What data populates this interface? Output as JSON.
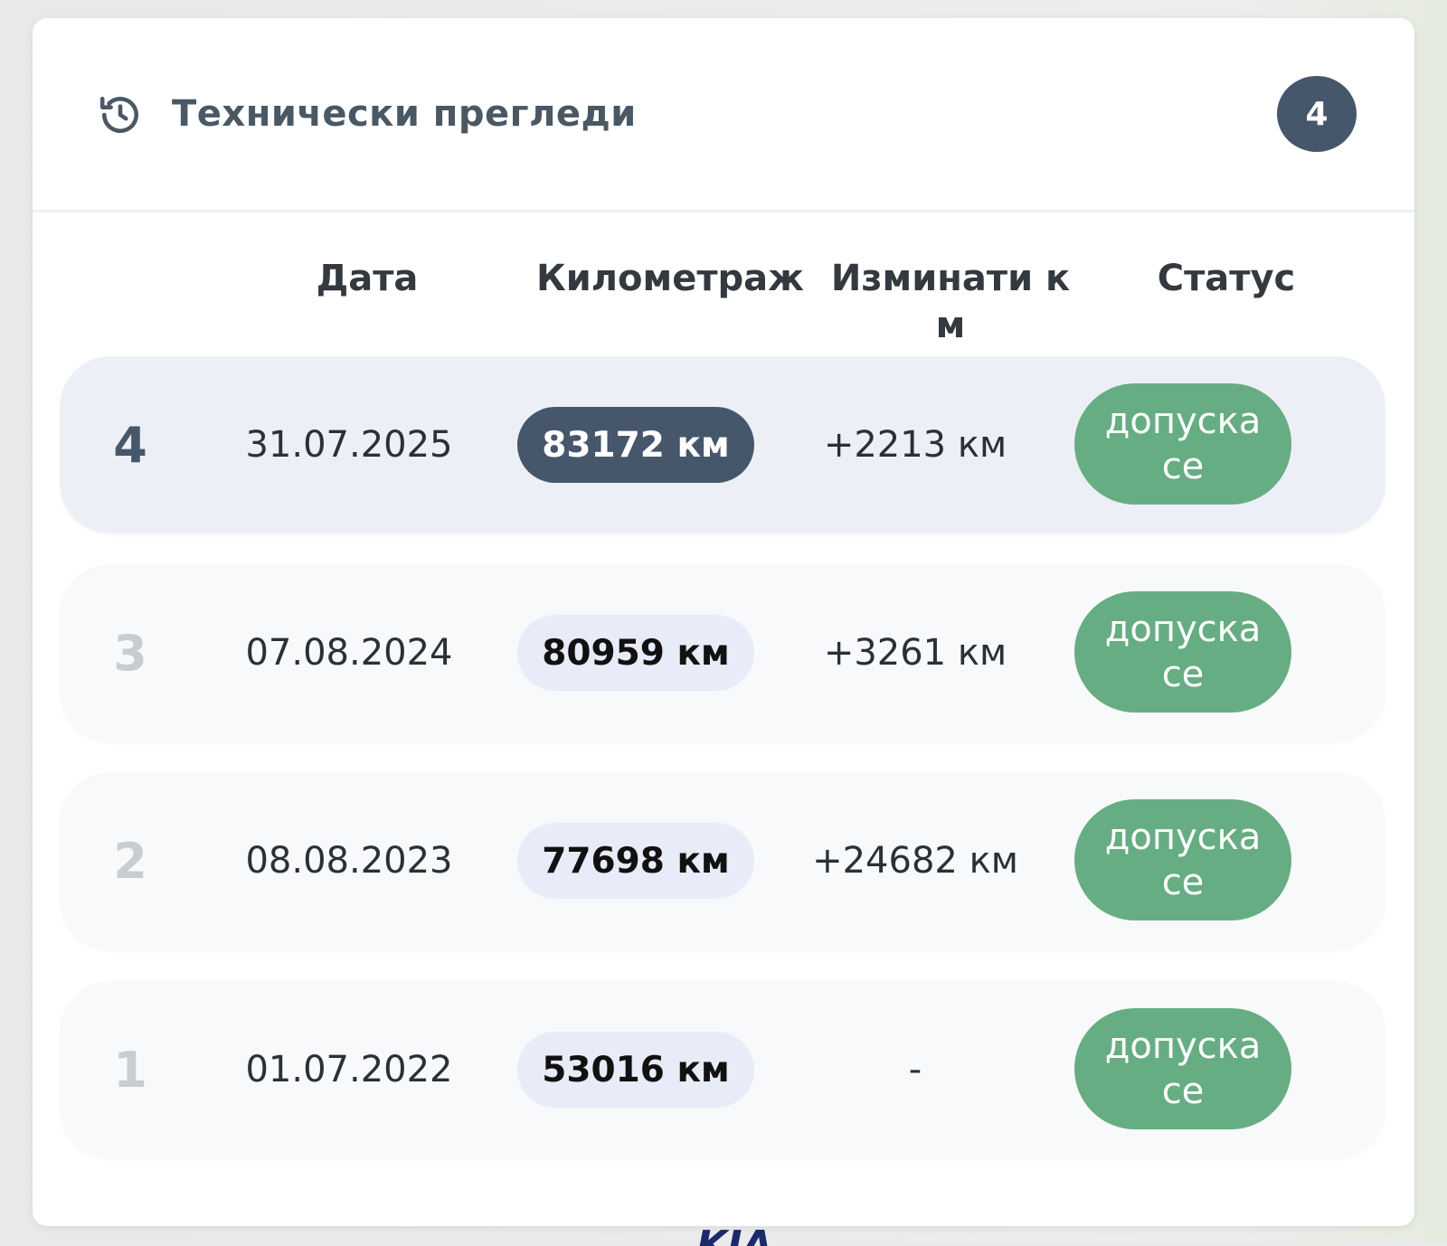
{
  "card": {
    "title": "Технически прегледи",
    "count": "4",
    "icon": "history-icon"
  },
  "columns": {
    "date": "Дата",
    "mileage": "Километраж",
    "traveled": "Изминати к\nм",
    "status": "Статус"
  },
  "rows": [
    {
      "num": "4",
      "date": "31.07.2025",
      "mileage": "83172 км",
      "traveled": "+2213 км",
      "status": "допуска се"
    },
    {
      "num": "3",
      "date": "07.08.2024",
      "mileage": "80959 км",
      "traveled": "+3261 км",
      "status": "допуска се"
    },
    {
      "num": "2",
      "date": "08.08.2023",
      "mileage": "77698 км",
      "traveled": "+24682 км",
      "status": "допуска се"
    },
    {
      "num": "1",
      "date": "01.07.2022",
      "mileage": "53016 км",
      "traveled": "-",
      "status": "допуска се"
    }
  ],
  "colors": {
    "accent_dark": "#46566b",
    "status_ok": "#67ad83",
    "pill_light": "#e8ebf8"
  }
}
